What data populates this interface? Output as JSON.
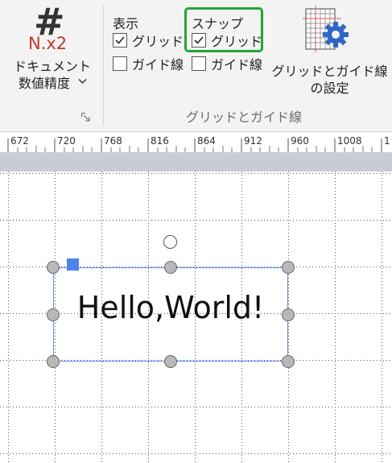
{
  "ribbon": {
    "doc_precision": {
      "glyph": "#",
      "sub": "N.x2",
      "label_line1": "ドキュメント",
      "label_line2": "数値精度",
      "chevron": "⌵"
    },
    "display": {
      "title": "表示",
      "grid": {
        "label": "グリッド",
        "checked": true
      },
      "guides": {
        "label": "ガイド線",
        "checked": false
      }
    },
    "snap": {
      "title": "スナップ",
      "grid": {
        "label": "グリッド",
        "checked": true
      },
      "guides": {
        "label": "ガイド線",
        "checked": false
      }
    },
    "grid_guide_settings": {
      "label_line1": "グリッドとガイド線",
      "label_line2": "の設定"
    },
    "group_caption": "グリッドとガイド線"
  },
  "ruler": {
    "labels": [
      "672",
      "720",
      "768",
      "816",
      "864",
      "912",
      "960",
      "1008",
      "1"
    ]
  },
  "canvas": {
    "text": "Hello,World!"
  },
  "colors": {
    "highlight": "#22a63a",
    "selection": "#5b8ff0",
    "anchor": "#4d84f0",
    "precision_sub": "#c0392b"
  }
}
